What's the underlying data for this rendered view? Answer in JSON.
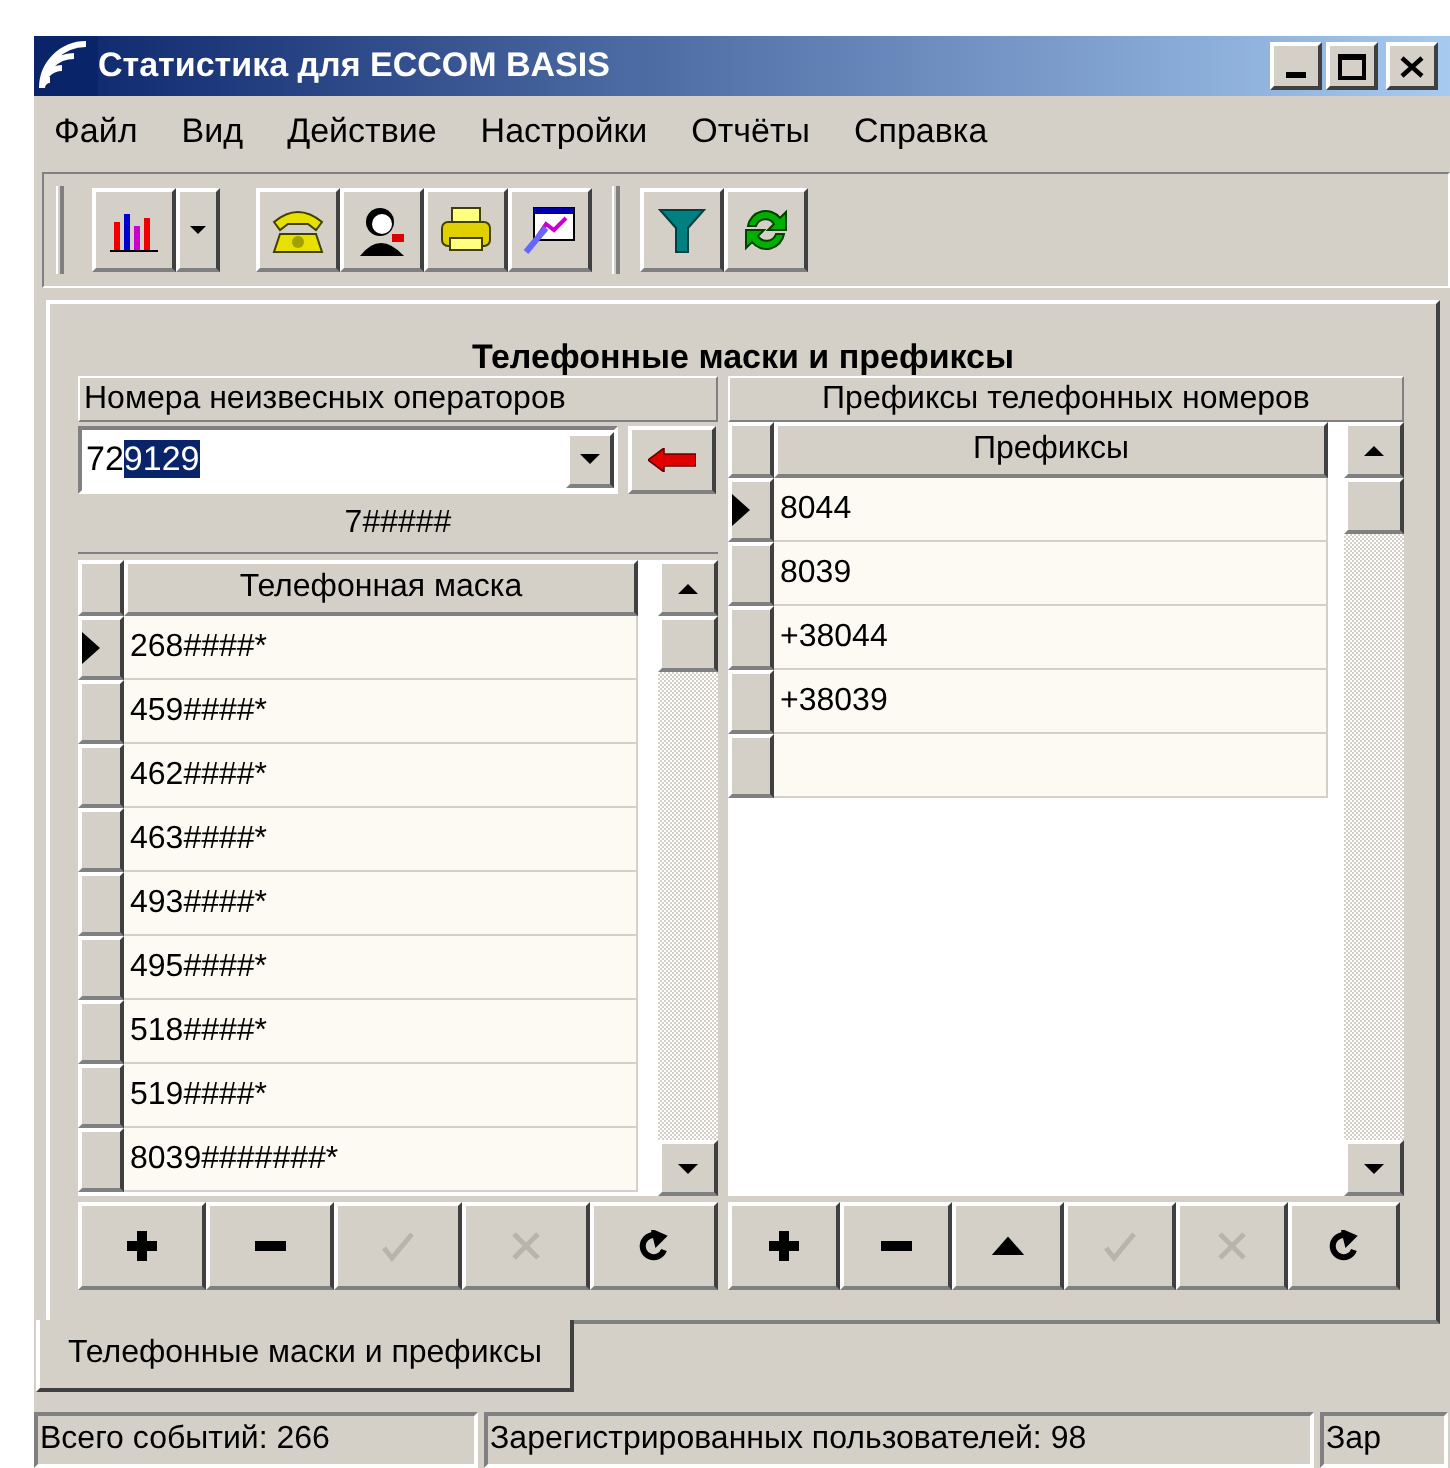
{
  "window": {
    "title": "Статистика для ECCOM BASIS"
  },
  "menu": [
    "Файл",
    "Вид",
    "Действие",
    "Настройки",
    "Отчёты",
    "Справка"
  ],
  "toolbar": [
    {
      "kind": "chart"
    },
    {
      "kind": "dropdown"
    },
    {
      "kind": "phone"
    },
    {
      "kind": "person"
    },
    {
      "kind": "printer"
    },
    {
      "kind": "report"
    },
    {
      "kind": "separator"
    },
    {
      "kind": "filter"
    },
    {
      "kind": "refresh"
    }
  ],
  "panel": {
    "title": "Телефонные маски и префиксы",
    "left": {
      "label": "Номера неизвесных операторов",
      "combo": {
        "parts": [
          {
            "text": "72",
            "selected": false
          },
          {
            "text": "9129",
            "selected": true
          }
        ]
      },
      "mask_preview": "7#####",
      "column": "Телефонная маска",
      "rows": [
        {
          "value": "268####*",
          "selected": true
        },
        {
          "value": "459####*",
          "selected": false
        },
        {
          "value": "462####*",
          "selected": false
        },
        {
          "value": "463####*",
          "selected": false
        },
        {
          "value": "493####*",
          "selected": false
        },
        {
          "value": "495####*",
          "selected": false
        },
        {
          "value": "518####*",
          "selected": false
        },
        {
          "value": "519####*",
          "selected": false
        },
        {
          "value": "8039#######*",
          "selected": false
        }
      ],
      "buttons": [
        {
          "kind": "add",
          "disabled": false
        },
        {
          "kind": "remove",
          "disabled": false
        },
        {
          "kind": "post",
          "disabled": true
        },
        {
          "kind": "cancel",
          "disabled": true
        },
        {
          "kind": "refresh",
          "disabled": false
        }
      ]
    },
    "right": {
      "label": "Префиксы телефонных номеров",
      "column": "Префиксы",
      "rows": [
        {
          "kind": "data",
          "value": "8044",
          "selected": true
        },
        {
          "kind": "data",
          "value": "8039",
          "selected": false
        },
        {
          "kind": "data",
          "value": "+38044",
          "selected": false
        },
        {
          "kind": "data",
          "value": "+38039",
          "selected": false
        },
        {
          "kind": "blank",
          "selected": false
        }
      ],
      "buttons": [
        {
          "kind": "add",
          "disabled": false
        },
        {
          "kind": "remove",
          "disabled": false
        },
        {
          "kind": "up",
          "disabled": false
        },
        {
          "kind": "post",
          "disabled": true
        },
        {
          "kind": "cancel",
          "disabled": true
        },
        {
          "kind": "refresh",
          "disabled": false
        }
      ]
    }
  },
  "tabs": [
    {
      "label": "Телефонные маски и префиксы",
      "selected": true
    }
  ],
  "status_bar": [
    "Всего событий: 266",
    "Зарегистрированных пользователей: 98",
    "Зар"
  ]
}
